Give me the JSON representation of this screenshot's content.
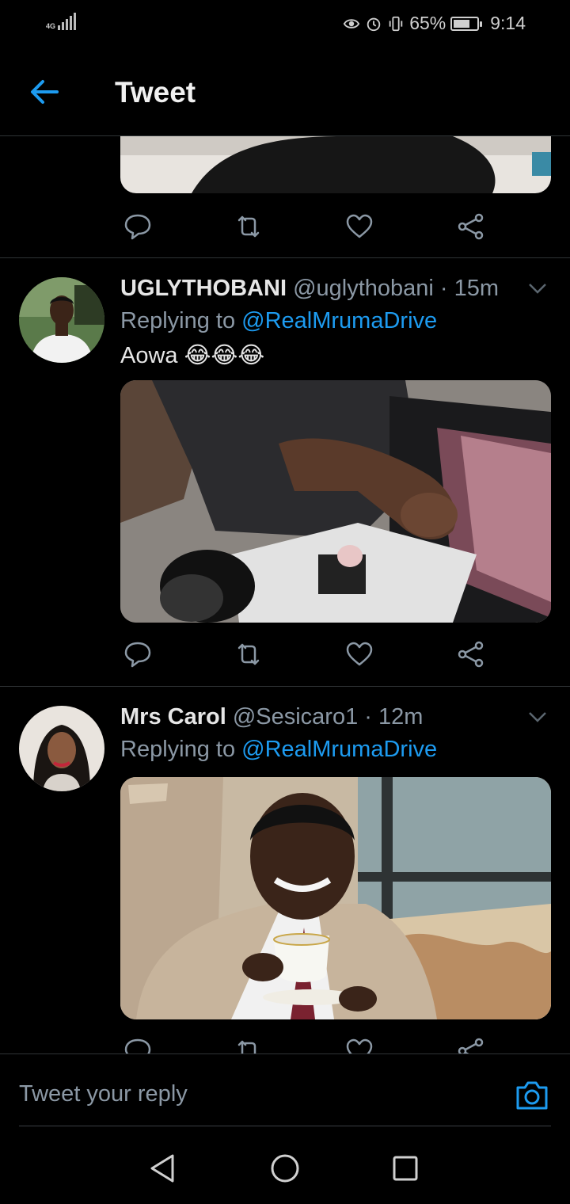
{
  "status_bar": {
    "network": "4G",
    "battery": "65%",
    "time": "9:14",
    "icons": [
      "eye-icon",
      "alarm-icon",
      "vibrate-icon",
      "battery-icon"
    ]
  },
  "header": {
    "title": "Tweet",
    "back_icon": "arrow-left-icon"
  },
  "tweets": [
    {
      "name": "UGLYTHOBANI",
      "handle": "@uglythobani",
      "time": "· 15m",
      "replying_prefix": "Replying to",
      "replying_to": "@RealMrumaDrive",
      "text": "Aowa 😂😂😂"
    },
    {
      "name": "Mrs Carol",
      "handle": "@Sesicaro1",
      "time": "· 12m",
      "replying_prefix": "Replying to",
      "replying_to": "@RealMrumaDrive",
      "text": ""
    }
  ],
  "reply": {
    "placeholder": "Tweet your reply"
  },
  "colors": {
    "background": "#000000",
    "accent": "#1d9bf0",
    "secondary_text": "#8b98a5",
    "divider": "#2f3336"
  }
}
